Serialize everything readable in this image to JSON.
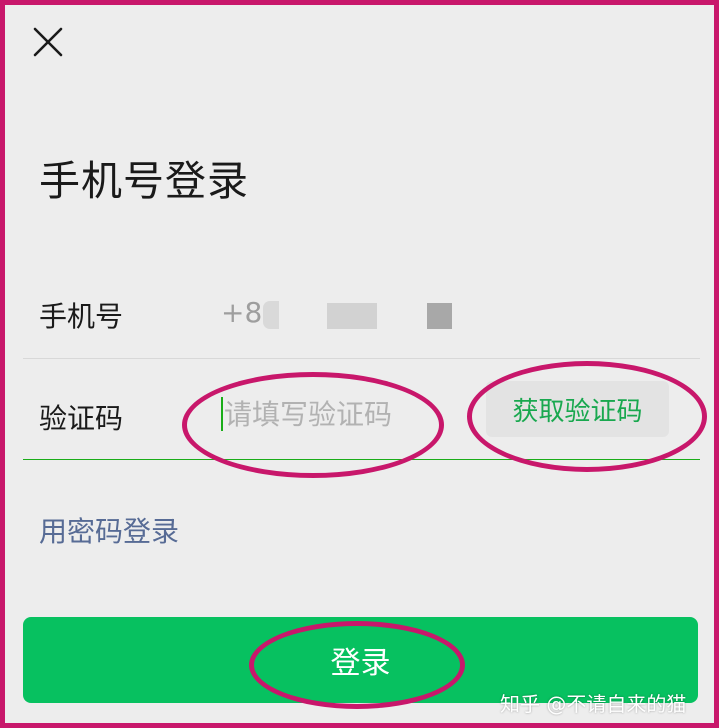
{
  "header": {
    "close_icon": "close-icon",
    "title": "手机号登录"
  },
  "phone_row": {
    "label": "手机号",
    "prefix": "+86"
  },
  "code_row": {
    "label": "验证码",
    "placeholder": "请填写验证码",
    "value": "",
    "get_code_label": "获取验证码"
  },
  "password_login_label": "用密码登录",
  "login_button_label": "登录",
  "watermark": "知乎 @不请自来的猫",
  "colors": {
    "accent_green": "#07c160",
    "link_blue": "#576b95",
    "annotation_magenta": "#c8176b",
    "background": "#ededed"
  }
}
